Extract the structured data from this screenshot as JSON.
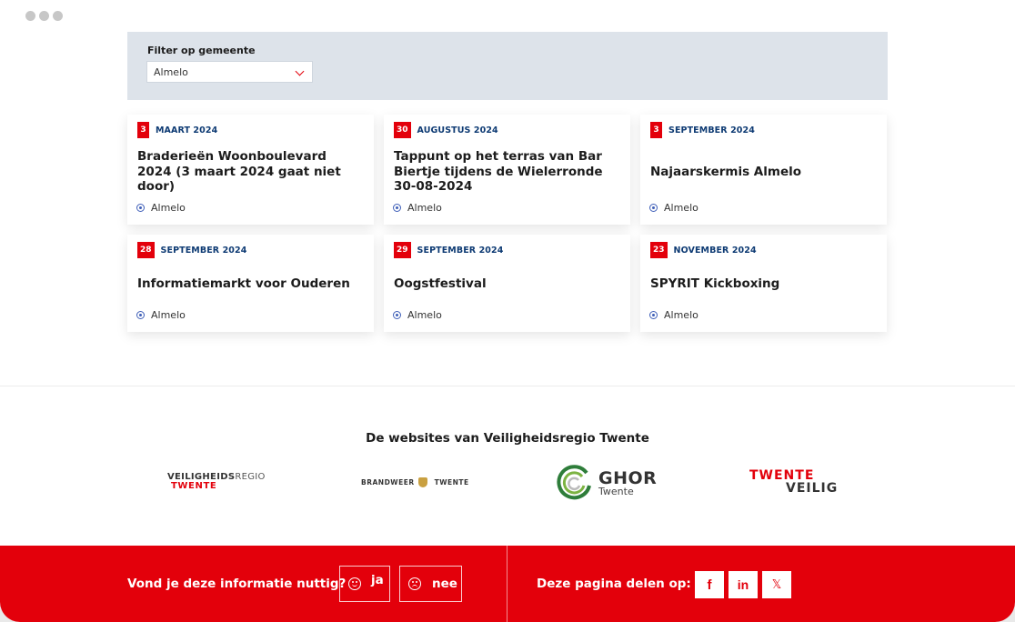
{
  "filter": {
    "label": "Filter op gemeente",
    "selected": "Almelo"
  },
  "events": [
    {
      "day": "3",
      "month": "MAART 2024",
      "title": "Braderieën Woonboulevard 2024 (3 maart 2024 gaat niet door)",
      "location": "Almelo"
    },
    {
      "day": "30",
      "month": "AUGUSTUS 2024",
      "title": "Tappunt op het terras van Bar Biertje tijdens de Wielerronde 30-08-2024",
      "location": "Almelo"
    },
    {
      "day": "3",
      "month": "SEPTEMBER 2024",
      "title": "Najaarskermis Almelo",
      "location": "Almelo"
    },
    {
      "day": "28",
      "month": "SEPTEMBER 2024",
      "title": "Informatiemarkt voor Ouderen",
      "location": "Almelo"
    },
    {
      "day": "29",
      "month": "SEPTEMBER 2024",
      "title": "Oogstfestival",
      "location": "Almelo"
    },
    {
      "day": "23",
      "month": "NOVEMBER 2024",
      "title": "SPYRIT Kickboxing",
      "location": "Almelo"
    }
  ],
  "websites": {
    "heading": "De websites van Veiligheidsregio Twente",
    "veiligheidsregio": {
      "line1_bold": "VEILIGHEIDS",
      "line1_light": "REGIO",
      "line2": "TWENTE"
    },
    "brandweer": {
      "left": "BRANDWEER",
      "right": "TWENTE"
    },
    "ghor": {
      "name": "GHOR",
      "sub": "Twente"
    },
    "twenteveilig": {
      "line1": "TWENTE",
      "line2": "VEILIG"
    }
  },
  "feedback": {
    "question": "Vond je deze informatie nuttig?",
    "yes": "ja",
    "no": "nee"
  },
  "share": {
    "label": "Deze pagina delen op:",
    "facebook": "f",
    "linkedin": "in",
    "x": "𝕏"
  },
  "colors": {
    "accent": "#e3000b",
    "month_text": "#0d3a73",
    "filter_panel": "#dde3ea",
    "pin": "#3f5fb8"
  }
}
